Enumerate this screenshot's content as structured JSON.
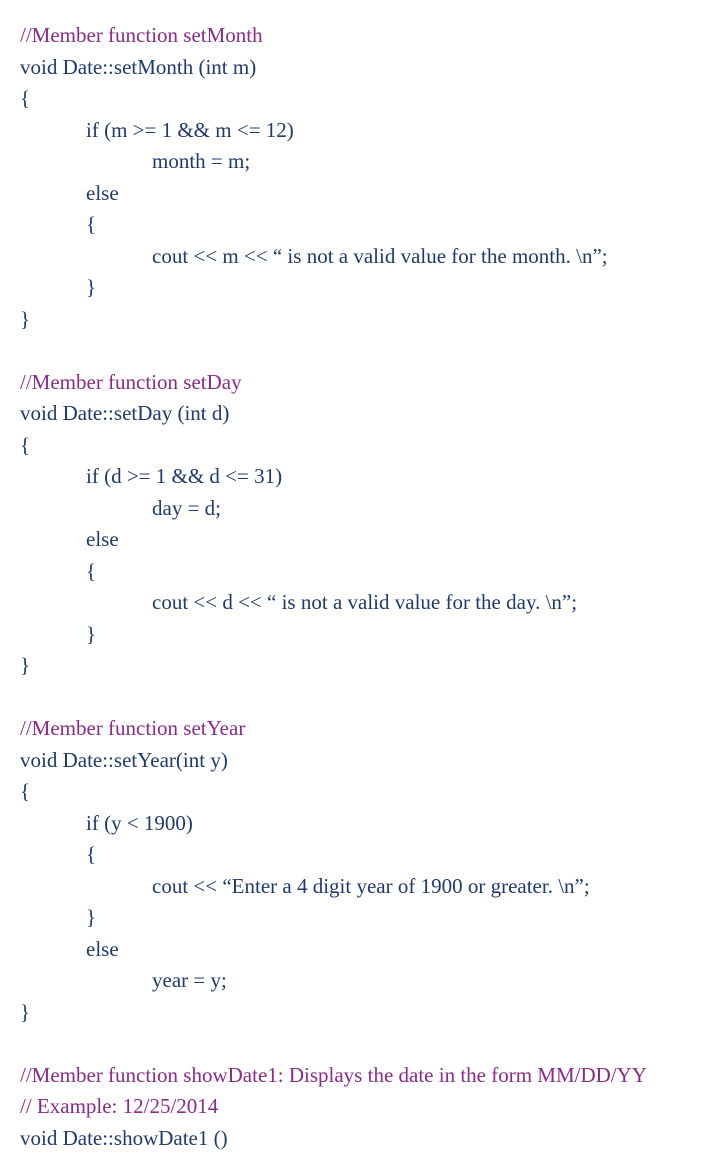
{
  "lines": [
    {
      "cls": "comment",
      "indent": 0,
      "text": "//Member function setMonth"
    },
    {
      "cls": "code",
      "indent": 0,
      "text": "void Date::setMonth (int m)"
    },
    {
      "cls": "code",
      "indent": 0,
      "text": "{"
    },
    {
      "cls": "code",
      "indent": 1,
      "text": "if (m >= 1 && m <= 12)"
    },
    {
      "cls": "code",
      "indent": 2,
      "text": "month = m;"
    },
    {
      "cls": "code",
      "indent": 1,
      "text": "else"
    },
    {
      "cls": "code",
      "indent": 1,
      "text": "{"
    },
    {
      "cls": "code",
      "indent": 2,
      "text": "cout << m << “ is not a valid value for the month. \\n”;"
    },
    {
      "cls": "code",
      "indent": 1,
      "text": "}"
    },
    {
      "cls": "code",
      "indent": 0,
      "text": "}"
    },
    {
      "cls": "code",
      "indent": 0,
      "text": ""
    },
    {
      "cls": "comment",
      "indent": 0,
      "text": "//Member function setDay"
    },
    {
      "cls": "code",
      "indent": 0,
      "text": "void Date::setDay (int d)"
    },
    {
      "cls": "code",
      "indent": 0,
      "text": "{"
    },
    {
      "cls": "code",
      "indent": 1,
      "text": "if (d >= 1 && d <= 31)"
    },
    {
      "cls": "code",
      "indent": 2,
      "text": "day = d;"
    },
    {
      "cls": "code",
      "indent": 1,
      "text": "else"
    },
    {
      "cls": "code",
      "indent": 1,
      "text": "{"
    },
    {
      "cls": "code",
      "indent": 2,
      "text": "cout << d << “ is not a valid value for the day. \\n”;"
    },
    {
      "cls": "code",
      "indent": 1,
      "text": "}"
    },
    {
      "cls": "code",
      "indent": 0,
      "text": "}"
    },
    {
      "cls": "code",
      "indent": 0,
      "text": ""
    },
    {
      "cls": "comment",
      "indent": 0,
      "text": "//Member function setYear"
    },
    {
      "cls": "code",
      "indent": 0,
      "text": "void Date::setYear(int y)"
    },
    {
      "cls": "code",
      "indent": 0,
      "text": "{"
    },
    {
      "cls": "code",
      "indent": 1,
      "text": "if (y < 1900)"
    },
    {
      "cls": "code",
      "indent": 1,
      "text": "{"
    },
    {
      "cls": "code",
      "indent": 2,
      "text": "cout << “Enter a 4 digit year of 1900 or greater. \\n”;"
    },
    {
      "cls": "code",
      "indent": 1,
      "text": "}"
    },
    {
      "cls": "code",
      "indent": 1,
      "text": "else"
    },
    {
      "cls": "code",
      "indent": 2,
      "text": "year = y;"
    },
    {
      "cls": "code",
      "indent": 0,
      "text": "}"
    },
    {
      "cls": "code",
      "indent": 0,
      "text": ""
    },
    {
      "cls": "comment",
      "indent": 0,
      "text": "//Member function showDate1: Displays the date in the form MM/DD/YY"
    },
    {
      "cls": "comment",
      "indent": 0,
      "text": "// Example: 12/25/2014"
    },
    {
      "cls": "code",
      "indent": 0,
      "text": "void Date::showDate1 ()"
    }
  ]
}
